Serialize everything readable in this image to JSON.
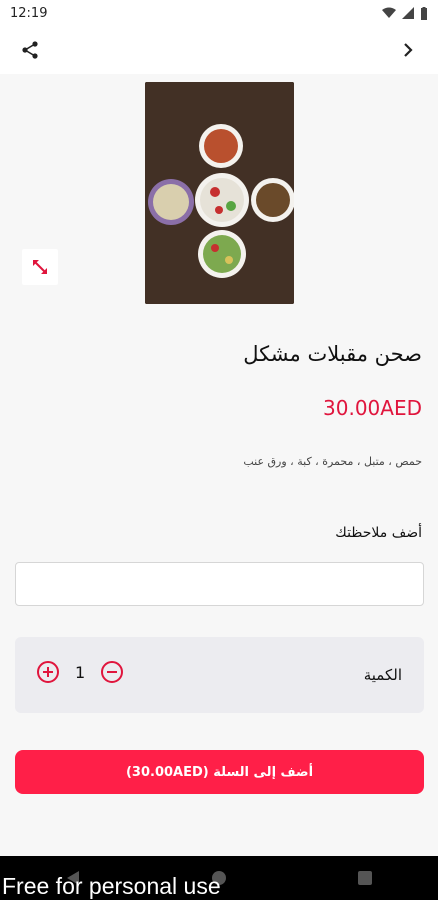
{
  "status": {
    "time": "12:19"
  },
  "product": {
    "title": "صحن مقبلات مشكل",
    "price": "30.00AED",
    "description": "حمص ، متبل ، محمرة ، كبة ، ورق عنب"
  },
  "notes": {
    "label": "أضف ملاحظتك",
    "value": ""
  },
  "quantity": {
    "label": "الكمية",
    "value": "1"
  },
  "cart_button": {
    "label": "أضف إلى السلة (30.00AED)"
  },
  "watermark": "Free for personal use",
  "colors": {
    "accent": "#ff1f48",
    "price": "#e0153d"
  }
}
